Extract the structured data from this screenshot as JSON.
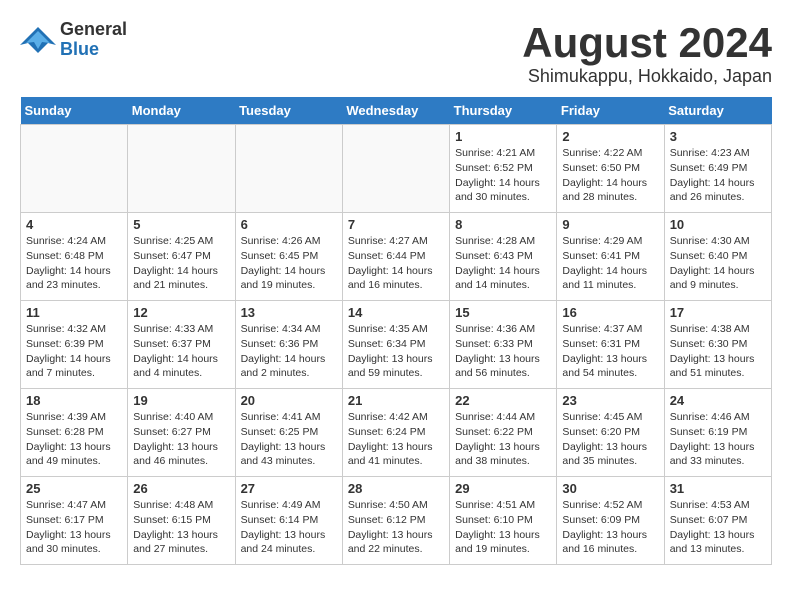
{
  "header": {
    "logo_general": "General",
    "logo_blue": "Blue",
    "title": "August 2024",
    "subtitle": "Shimukappu, Hokkaido, Japan"
  },
  "weekdays": [
    "Sunday",
    "Monday",
    "Tuesday",
    "Wednesday",
    "Thursday",
    "Friday",
    "Saturday"
  ],
  "weeks": [
    [
      {
        "day": "",
        "detail": ""
      },
      {
        "day": "",
        "detail": ""
      },
      {
        "day": "",
        "detail": ""
      },
      {
        "day": "",
        "detail": ""
      },
      {
        "day": "1",
        "detail": "Sunrise: 4:21 AM\nSunset: 6:52 PM\nDaylight: 14 hours\nand 30 minutes."
      },
      {
        "day": "2",
        "detail": "Sunrise: 4:22 AM\nSunset: 6:50 PM\nDaylight: 14 hours\nand 28 minutes."
      },
      {
        "day": "3",
        "detail": "Sunrise: 4:23 AM\nSunset: 6:49 PM\nDaylight: 14 hours\nand 26 minutes."
      }
    ],
    [
      {
        "day": "4",
        "detail": "Sunrise: 4:24 AM\nSunset: 6:48 PM\nDaylight: 14 hours\nand 23 minutes."
      },
      {
        "day": "5",
        "detail": "Sunrise: 4:25 AM\nSunset: 6:47 PM\nDaylight: 14 hours\nand 21 minutes."
      },
      {
        "day": "6",
        "detail": "Sunrise: 4:26 AM\nSunset: 6:45 PM\nDaylight: 14 hours\nand 19 minutes."
      },
      {
        "day": "7",
        "detail": "Sunrise: 4:27 AM\nSunset: 6:44 PM\nDaylight: 14 hours\nand 16 minutes."
      },
      {
        "day": "8",
        "detail": "Sunrise: 4:28 AM\nSunset: 6:43 PM\nDaylight: 14 hours\nand 14 minutes."
      },
      {
        "day": "9",
        "detail": "Sunrise: 4:29 AM\nSunset: 6:41 PM\nDaylight: 14 hours\nand 11 minutes."
      },
      {
        "day": "10",
        "detail": "Sunrise: 4:30 AM\nSunset: 6:40 PM\nDaylight: 14 hours\nand 9 minutes."
      }
    ],
    [
      {
        "day": "11",
        "detail": "Sunrise: 4:32 AM\nSunset: 6:39 PM\nDaylight: 14 hours\nand 7 minutes."
      },
      {
        "day": "12",
        "detail": "Sunrise: 4:33 AM\nSunset: 6:37 PM\nDaylight: 14 hours\nand 4 minutes."
      },
      {
        "day": "13",
        "detail": "Sunrise: 4:34 AM\nSunset: 6:36 PM\nDaylight: 14 hours\nand 2 minutes."
      },
      {
        "day": "14",
        "detail": "Sunrise: 4:35 AM\nSunset: 6:34 PM\nDaylight: 13 hours\nand 59 minutes."
      },
      {
        "day": "15",
        "detail": "Sunrise: 4:36 AM\nSunset: 6:33 PM\nDaylight: 13 hours\nand 56 minutes."
      },
      {
        "day": "16",
        "detail": "Sunrise: 4:37 AM\nSunset: 6:31 PM\nDaylight: 13 hours\nand 54 minutes."
      },
      {
        "day": "17",
        "detail": "Sunrise: 4:38 AM\nSunset: 6:30 PM\nDaylight: 13 hours\nand 51 minutes."
      }
    ],
    [
      {
        "day": "18",
        "detail": "Sunrise: 4:39 AM\nSunset: 6:28 PM\nDaylight: 13 hours\nand 49 minutes."
      },
      {
        "day": "19",
        "detail": "Sunrise: 4:40 AM\nSunset: 6:27 PM\nDaylight: 13 hours\nand 46 minutes."
      },
      {
        "day": "20",
        "detail": "Sunrise: 4:41 AM\nSunset: 6:25 PM\nDaylight: 13 hours\nand 43 minutes."
      },
      {
        "day": "21",
        "detail": "Sunrise: 4:42 AM\nSunset: 6:24 PM\nDaylight: 13 hours\nand 41 minutes."
      },
      {
        "day": "22",
        "detail": "Sunrise: 4:44 AM\nSunset: 6:22 PM\nDaylight: 13 hours\nand 38 minutes."
      },
      {
        "day": "23",
        "detail": "Sunrise: 4:45 AM\nSunset: 6:20 PM\nDaylight: 13 hours\nand 35 minutes."
      },
      {
        "day": "24",
        "detail": "Sunrise: 4:46 AM\nSunset: 6:19 PM\nDaylight: 13 hours\nand 33 minutes."
      }
    ],
    [
      {
        "day": "25",
        "detail": "Sunrise: 4:47 AM\nSunset: 6:17 PM\nDaylight: 13 hours\nand 30 minutes."
      },
      {
        "day": "26",
        "detail": "Sunrise: 4:48 AM\nSunset: 6:15 PM\nDaylight: 13 hours\nand 27 minutes."
      },
      {
        "day": "27",
        "detail": "Sunrise: 4:49 AM\nSunset: 6:14 PM\nDaylight: 13 hours\nand 24 minutes."
      },
      {
        "day": "28",
        "detail": "Sunrise: 4:50 AM\nSunset: 6:12 PM\nDaylight: 13 hours\nand 22 minutes."
      },
      {
        "day": "29",
        "detail": "Sunrise: 4:51 AM\nSunset: 6:10 PM\nDaylight: 13 hours\nand 19 minutes."
      },
      {
        "day": "30",
        "detail": "Sunrise: 4:52 AM\nSunset: 6:09 PM\nDaylight: 13 hours\nand 16 minutes."
      },
      {
        "day": "31",
        "detail": "Sunrise: 4:53 AM\nSunset: 6:07 PM\nDaylight: 13 hours\nand 13 minutes."
      }
    ]
  ]
}
